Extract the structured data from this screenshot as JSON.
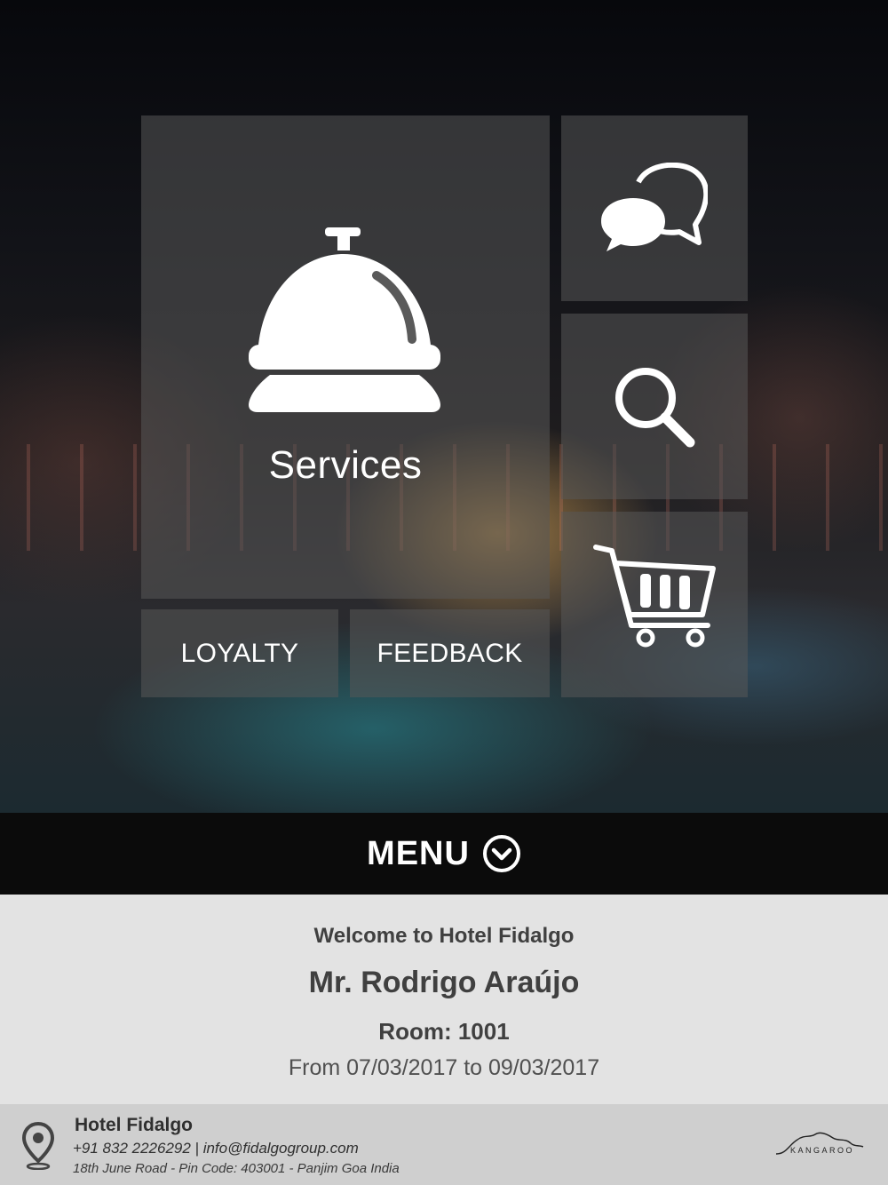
{
  "tiles": {
    "services_label": "Services",
    "loyalty_label": "LOYALTY",
    "feedback_label": "FEEDBACK",
    "icons": [
      "service-bell-icon",
      "chat-bubbles-icon",
      "search-icon",
      "shopping-cart-icon"
    ]
  },
  "menu": {
    "label": "MENU",
    "icon": "chevron-down-circle-icon"
  },
  "welcome": {
    "greeting": "Welcome to Hotel Fidalgo",
    "guest_name": "Mr. Rodrigo Araújo",
    "room": "Room: 1001",
    "dates": "From 07/03/2017 to 09/03/2017"
  },
  "footer": {
    "hotel_name": "Hotel Fidalgo",
    "contact": "+91 832 2226292 | info@fidalgogroup.com",
    "address": "18th June Road  - Pin Code: 403001 - Panjim Goa India",
    "brand": "KANGAROO",
    "location_icon": "location-pin-icon"
  },
  "colors": {
    "tile_background": "#585858",
    "menu_bar": "#0b0b0b",
    "welcome_panel": "#e3e3e3",
    "footer_panel": "#cfcfcf"
  }
}
